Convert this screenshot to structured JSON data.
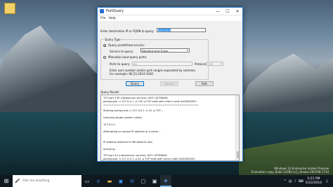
{
  "window": {
    "title": "PortQuery",
    "menu": [
      "File",
      "Help"
    ],
    "controls": {
      "minimize": "—",
      "maximize": "☐",
      "close": "✕"
    }
  },
  "form": {
    "dest_label": "Enter destination IP or FQDN to query:",
    "dest_value": "127.0.0.1",
    "query_type_label": "Query Type",
    "predefined_label": "Query predefined service:",
    "service_label": "Service to query:",
    "service_value": "Domains and Trusts",
    "manual_label": "Manually input query ports:",
    "ports_label": "Ports to query:",
    "ports_value": "80",
    "protocol_label": "Protocol:",
    "protocol_value": "TCP",
    "hint_line1": "Enter port number and/or port ranges separated by commas.",
    "hint_line2": "For example: 80,53,1024-1030",
    "buttons": {
      "query": "Query",
      "cancel": "Cancel",
      "exit": "Exit"
    }
  },
  "results": {
    "label": "Query Result:",
    "lines": [
      "TCP port 139 (netbios-ssn service): NOT LISTENING",
      "portqry.exe -n 127.0.0.1 -e 139 -p TCP exits with return code 0x00000001.",
      "=============================================",
      "Starting portqry.exe -n 127.0.0.1 -e 42 -p TCP ...",
      "",
      "Querying target system called:",
      "",
      " 127.0.0.1",
      "",
      "Attempting to resolve IP address to a name...",
      "",
      "",
      "IP address resolved to Windows10-lwin",
      "",
      "querying...",
      "",
      "TCP port 42 (nameserver service): NOT LISTENING",
      "portqry.exe -n 127.0.0.1 -e 42 -p TCP exits with return code 0x00000001."
    ]
  },
  "watermark": {
    "line1": "Windows 10 Enterprise Insider Preview",
    "line2": "Evaluation copy. Build 14393.rs1_release.160708-1734"
  },
  "taskbar": {
    "search_placeholder": "Ask me anything",
    "time": "5:21 PM",
    "date": "5/22/2016"
  },
  "icons": {
    "start": "windows-logo",
    "search": "microphone",
    "taskview": "task-view",
    "edge": "edge",
    "explorer": "folder",
    "store": "store",
    "mail": "mail",
    "app1": "app",
    "app2": "app",
    "portquery": "portquery"
  }
}
